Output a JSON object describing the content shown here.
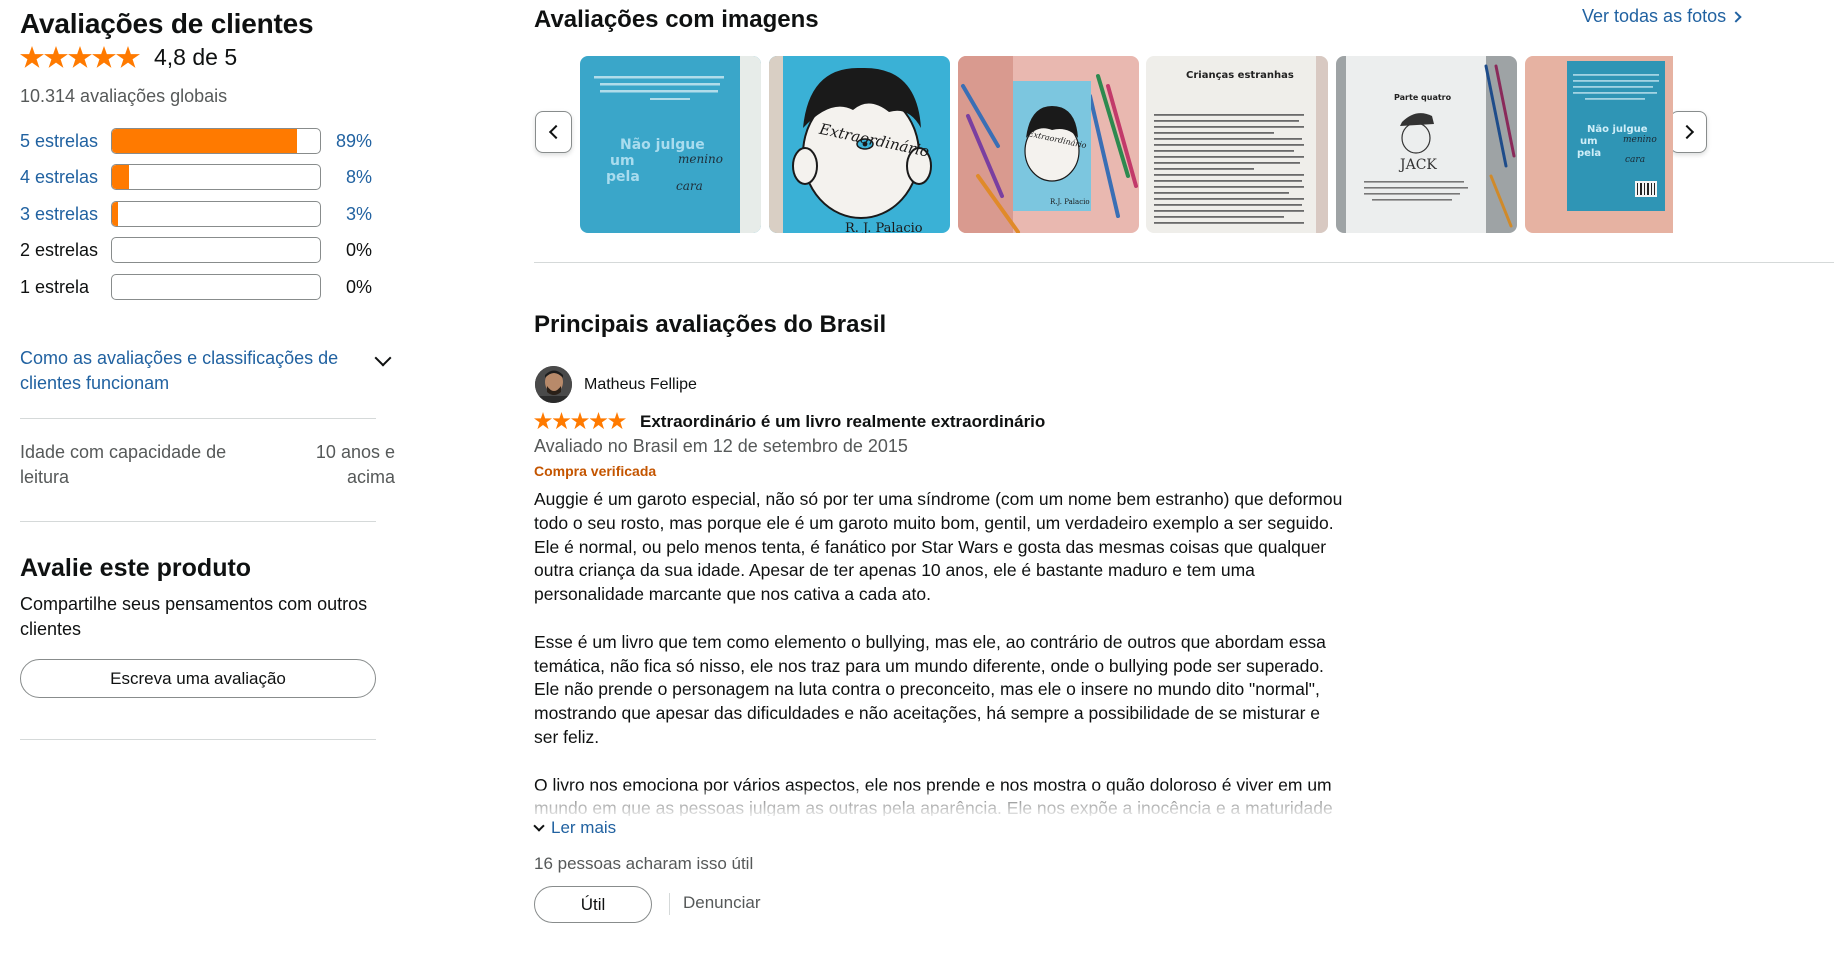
{
  "summary": {
    "title": "Avaliações de clientes",
    "average": 4.8,
    "average_text": "4,8 de 5",
    "global_count": "10.314 avaliações globais",
    "star_color": "#ff7a00",
    "link_color": "#2162a1",
    "histogram": [
      {
        "label": "5 estrelas",
        "percent": 89,
        "percent_text": "89%",
        "link": true
      },
      {
        "label": "4 estrelas",
        "percent": 8,
        "percent_text": "8%",
        "link": true
      },
      {
        "label": "3 estrelas",
        "percent": 3,
        "percent_text": "3%",
        "link": true
      },
      {
        "label": "2 estrelas",
        "percent": 0,
        "percent_text": "0%",
        "link": false
      },
      {
        "label": "1 estrela",
        "percent": 0,
        "percent_text": "0%",
        "link": false
      }
    ],
    "how_it_works": "Como as avaliações e classificações de clientes funcionam",
    "how_icon": "chevron-down-icon"
  },
  "attributes": {
    "reading_age_label": "Idade com capacidade de leitura",
    "reading_age_value": "10 anos e acima"
  },
  "review_this": {
    "title": "Avalie este produto",
    "subtitle": "Compartilhe seus pensamentos com outros clientes",
    "button": "Escreva uma avaliação"
  },
  "images": {
    "title": "Avaliações com imagens",
    "see_all": "Ver todas as fotos",
    "prev_icon": "chevron-left-icon",
    "next_icon": "chevron-right-icon",
    "thumbnails": [
      {
        "id": "teal-cover-quote",
        "caption_lines": [
          "Não julgue",
          "um",
          "pela"
        ],
        "handwriting": [
          "menino",
          "cara"
        ]
      },
      {
        "id": "wonder-face-cover",
        "cover_text": "Extraordinário",
        "author": "R. J. Palacio"
      },
      {
        "id": "book-on-desk",
        "cover_text": "Extraordinário",
        "author": "R.J. Palacio"
      },
      {
        "id": "page-criancas-estranhas",
        "page_heading": "Crianças estranhas"
      },
      {
        "id": "page-parte-quatro",
        "page_heading": "Parte quatro",
        "sketch_label": "JACK"
      },
      {
        "id": "back-cover",
        "caption_lines": [
          "Não julgue",
          "um",
          "pela"
        ],
        "handwriting": [
          "menino",
          "cara"
        ]
      }
    ]
  },
  "top_reviews": {
    "title": "Principais avaliações do Brasil",
    "review": {
      "author": "Matheus Fellipe",
      "rating": 5,
      "headline": "Extraordinário é um livro realmente extraordinário",
      "date": "Avaliado no Brasil em 12 de setembro de 2015",
      "verified": "Compra verificada",
      "verified_color": "#c45500",
      "paragraphs": [
        "Auggie é um garoto especial, não só por ter uma síndrome (com um nome bem estranho) que deformou todo o seu rosto, mas porque ele é um garoto muito bom, gentil, um verdadeiro exemplo a ser seguido. Ele é normal, ou pelo menos tenta, é fanático por Star Wars e gosta das mesmas coisas que qualquer outra criança da sua idade. Apesar de ter apenas 10 anos, ele é bastante maduro e tem uma personalidade marcante que nos cativa a cada ato.",
        "Esse é um livro que tem como elemento o bullying, mas ele, ao contrário de outros que abordam essa temática, não fica só nisso, ele nos traz para um mundo diferente, onde o bullying pode ser superado. Ele não prende o personagem na luta contra o preconceito, mas ele o insere no mundo dito \"normal\", mostrando que apesar das dificuldades e não aceitações, há sempre a possibilidade de se misturar e ser feliz.",
        "O livro nos emociona por vários aspectos, ele nos prende e nos mostra o quão doloroso é viver em um mundo em que as pessoas julgam as outras pela aparência. Ele nos expõe a inocência e a maturidade de"
      ],
      "read_more": "Ler mais",
      "helpful_count": "16 pessoas acharam isso útil",
      "helpful_button": "Útil",
      "report": "Denunciar"
    }
  }
}
